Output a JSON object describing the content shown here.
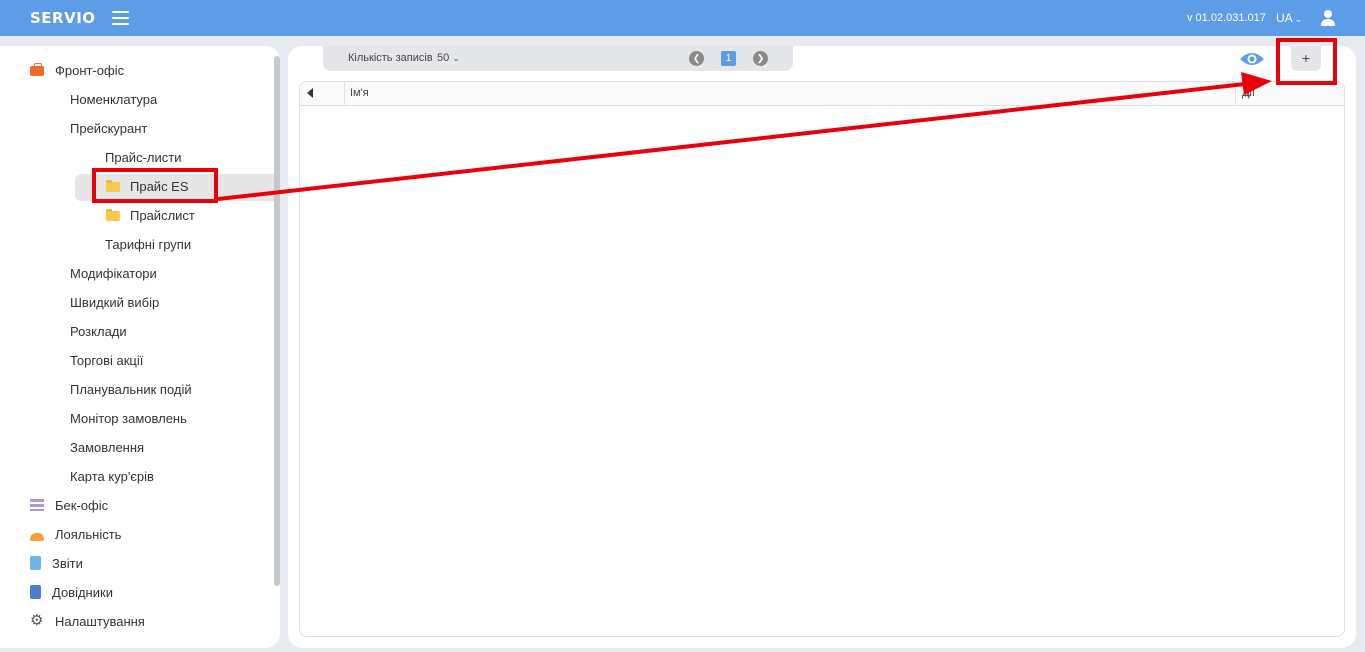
{
  "header": {
    "logo": "SERVIO",
    "version": "v 01.02.031.017",
    "language": "UA"
  },
  "sidebar": {
    "items": [
      {
        "label": "Фронт-офіс",
        "icon": "briefcase-icon"
      },
      {
        "label": "Номенклатура"
      },
      {
        "label": "Прейскурант"
      },
      {
        "label": "Прайс-листи"
      },
      {
        "label": "Прайс ES",
        "icon": "folder-icon",
        "selected": true
      },
      {
        "label": "Прайслист",
        "icon": "folder-icon"
      },
      {
        "label": "Тарифні групи"
      },
      {
        "label": "Модифікатори"
      },
      {
        "label": "Швидкий вибір"
      },
      {
        "label": "Розклади"
      },
      {
        "label": "Торгові акції"
      },
      {
        "label": "Планувальник подій"
      },
      {
        "label": "Монітор замовлень"
      },
      {
        "label": "Замовлення"
      },
      {
        "label": "Карта кур'єрів"
      },
      {
        "label": "Бек-офіс",
        "icon": "list-icon"
      },
      {
        "label": "Лояльність",
        "icon": "loyalty-icon"
      },
      {
        "label": "Звіти",
        "icon": "report-icon"
      },
      {
        "label": "Довідники",
        "icon": "book-icon"
      },
      {
        "label": "Налаштування",
        "icon": "gear-icon"
      }
    ]
  },
  "toolbar": {
    "records_label": "Кількість записів",
    "records_value": "50",
    "current_page": "1",
    "add_label": "+"
  },
  "table": {
    "columns": [
      "Ім'я",
      "Дії"
    ]
  },
  "colors": {
    "accent": "#5d9ce6",
    "annotation": "#e8000b"
  }
}
